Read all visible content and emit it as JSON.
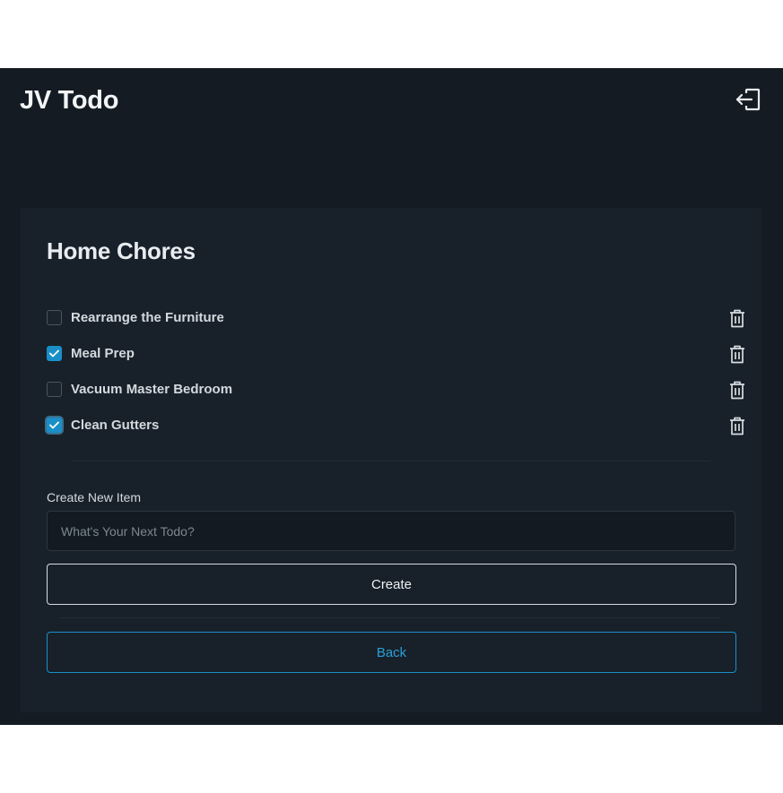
{
  "app": {
    "title": "JV Todo",
    "logout_icon": "logout-icon"
  },
  "list": {
    "title": "Home Chores",
    "items": [
      {
        "label": "Rearrange the Furniture",
        "checked": false
      },
      {
        "label": "Meal Prep",
        "checked": true
      },
      {
        "label": "Vacuum Master Bedroom",
        "checked": false
      },
      {
        "label": "Clean Gutters",
        "checked": true
      }
    ],
    "delete_icon": "trash-icon",
    "check_icon": "checkmark-icon"
  },
  "form": {
    "label": "Create New Item",
    "input_value": "",
    "input_placeholder": "What's Your Next Todo?",
    "create_label": "Create",
    "back_label": "Back"
  },
  "colors": {
    "page_background": "#141b22",
    "card_background": "#18212a",
    "accent": "#1a8fc7",
    "text": "#d4d9de"
  }
}
